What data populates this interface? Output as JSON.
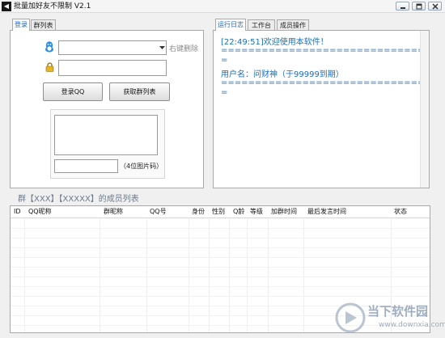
{
  "window": {
    "title": "批量加好友不限制 V2.1",
    "app_icon": "◀"
  },
  "left_tabs": [
    "登录",
    "群列表"
  ],
  "login": {
    "account_placeholder": "",
    "right_click_delete": "右键删除",
    "password_value": "",
    "login_button": "登录QQ",
    "get_groups_button": "获取群列表",
    "captcha_hint": "（4位图片码）",
    "captcha_value": ""
  },
  "right_tabs": [
    "运行日志",
    "工作台",
    "成员操作"
  ],
  "log": {
    "lines": [
      "[22:49:51]欢迎使用本软件！",
      "==================================",
      "=",
      "用户名：问财神（于99999到期）",
      "==================================",
      "="
    ]
  },
  "members": {
    "title": "群【XXX】【XXXXX】的成员列表",
    "columns": [
      "ID",
      "QQ昵称",
      "群昵称",
      "QQ号",
      "身份",
      "性别",
      "Q龄",
      "等级",
      "加群时间",
      "最后发言时间",
      "状态"
    ],
    "rows": []
  },
  "watermark": {
    "text": "当下软件园",
    "url": "www.downxia.com"
  },
  "icons": {
    "qq": "qq-penguin-icon",
    "lock": "lock-icon",
    "dropdown": "chevron-down-icon"
  },
  "colors": {
    "accent": "#1565c0",
    "log_text": "#1a6fb8",
    "watermark": "#8fa0b4"
  }
}
